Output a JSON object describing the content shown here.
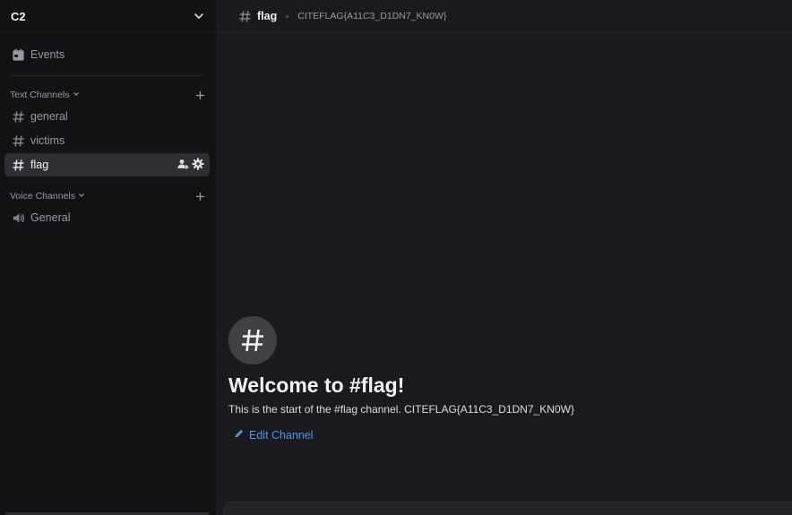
{
  "server": {
    "name": "C2"
  },
  "sidebar": {
    "events_label": "Events",
    "text_category": "Text Channels",
    "voice_category": "Voice Channels",
    "text_channels": [
      {
        "name": "general"
      },
      {
        "name": "victims"
      },
      {
        "name": "flag",
        "active": true
      }
    ],
    "voice_channels": [
      {
        "name": "General"
      }
    ]
  },
  "channel": {
    "name": "flag",
    "topic": "CITEFLAG{A11C3_D1DN7_KN0W}"
  },
  "welcome": {
    "title": "Welcome to #flag!",
    "subtitle": "This is the start of the #flag channel. CITEFLAG{A11C3_D1DN7_KN0W}",
    "edit_label": "Edit Channel"
  },
  "colors": {
    "sidebar_bg": "#121214",
    "main_bg": "#1a1a1e",
    "active_item": "#2e2f34",
    "link": "#4c94e7",
    "muted": "#949ba4"
  }
}
